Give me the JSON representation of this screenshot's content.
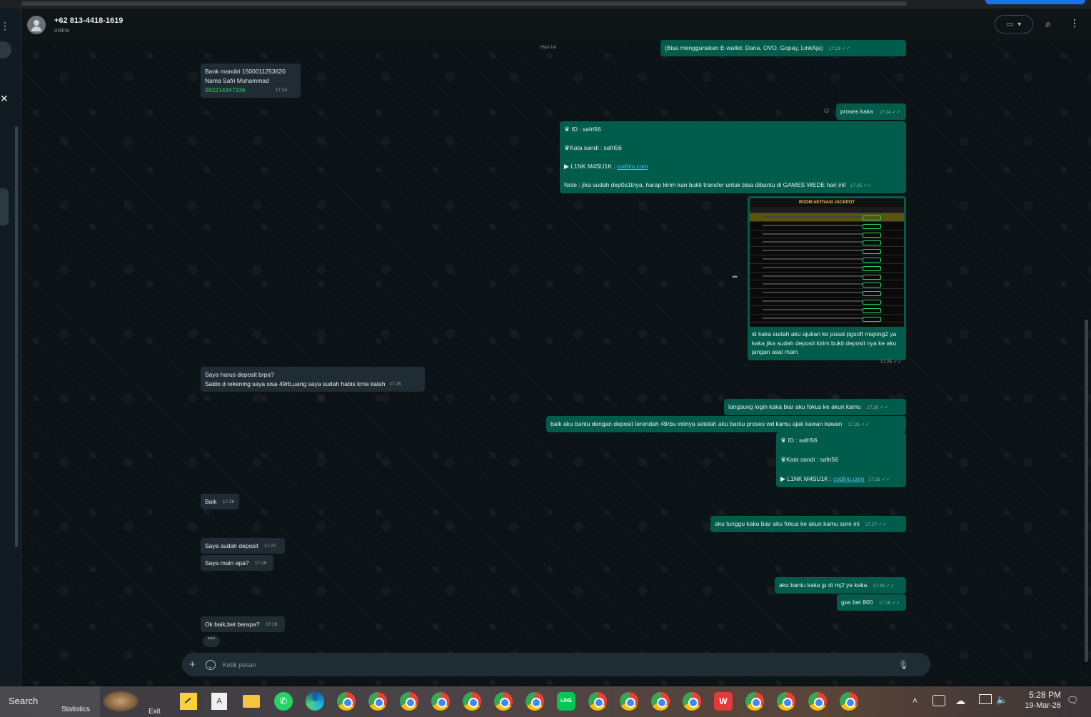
{
  "header": {
    "contact_name": "+62 813-4418-1619",
    "contact_status": "online"
  },
  "chat": {
    "date_chip": "Hari ini",
    "messages": [
      {
        "dir": "out",
        "text": "(Bisa menggunakan E-wallet: Dana, OVO, Gopay, LinkAja)",
        "time": "17.23"
      },
      {
        "dir": "in",
        "line1": "Bank mandiri 1500011253620",
        "line2": "Nama Safri Muhammad",
        "line3": "082214347336",
        "time": "17.24"
      },
      {
        "dir": "out",
        "text": "proses kaka",
        "time": "17.24"
      },
      {
        "dir": "out",
        "id_line": "ID :  safri56",
        "pass_line": "Kata sandi : safri56",
        "link_label": "L1NK M4SU1K : ",
        "link": "codhiu.com",
        "note": "Note : jika sudah dep0s1tnya, harap kirim kan bukti transfer untuk bisa dibantu di GAMES WEDE hari ini!",
        "time": "17.25"
      },
      {
        "dir": "out",
        "image_title": "ROOM AKTIVASI JACKPOT",
        "caption": "id kaka sudah aku ajukan ke pusat pgsoft majong2 ya kaka jika sudah deposit kirim bukti deposit nya ke aku jangan asal main",
        "time": "17.25"
      },
      {
        "dir": "in",
        "line1": "Saya harus deposit brpa?",
        "line2": "Saldo d rekening saya sisa 49rb,uang saya sudah habis krna kalah",
        "time": "17.25"
      },
      {
        "dir": "out",
        "text": "langsung login kaka biar aku fokus ke akun kamu",
        "time": "17.26"
      },
      {
        "dir": "out",
        "text": "baik aku bantu dengan deposit terendah 49rbu intinya setelah aku bantu proses wd kamu ajak kawan kawan",
        "time": "17.26"
      },
      {
        "dir": "out",
        "id_line": "ID :  safri56",
        "pass_line": "Kata sandi : safri56",
        "link_label": "L1NK M4SU1K : ",
        "link": "codhiu.com",
        "time": "17.26"
      },
      {
        "dir": "in",
        "text": "Baik",
        "time": "17.26"
      },
      {
        "dir": "out",
        "text": "aku tunggu kaka biar aku fokus ke akun kamu sore ini",
        "time": "17.27"
      },
      {
        "dir": "in",
        "text": "Saya sudah deposit",
        "time": "17.27"
      },
      {
        "dir": "in",
        "text": "Saya main apa?",
        "time": "17.28"
      },
      {
        "dir": "out",
        "text": "aku bantu kaka jp di mj2 ya kaka",
        "time": "17.28"
      },
      {
        "dir": "out",
        "text": "gas bet 800",
        "time": "17.28"
      },
      {
        "dir": "in",
        "text": "Ok baik,bet berapa?",
        "time": "17.28"
      }
    ]
  },
  "composer": {
    "placeholder": "Ketik pesan"
  },
  "taskbar": {
    "search_label": "Search",
    "statistics_label": "Statistics",
    "exit_label": "Exit",
    "time": "5:28 PM",
    "date": "19-Mar-26"
  },
  "colors": {
    "incoming_bubble": "#202c33",
    "outgoing_bubble": "#005c4b",
    "link": "#25d366"
  }
}
